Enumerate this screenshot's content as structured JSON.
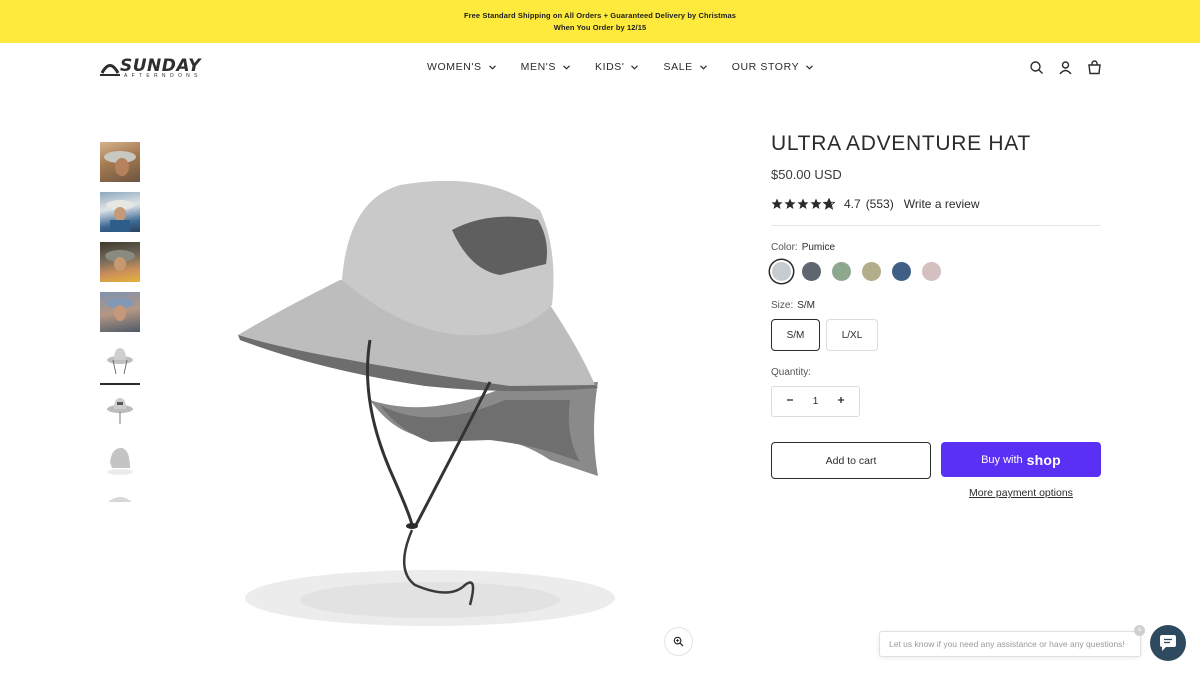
{
  "announcement": {
    "line1": "Free Standard Shipping on All Orders + Guaranteed Delivery by Christmas",
    "line2": "When You Order by 12/15"
  },
  "brand": {
    "name": "SUNDAY",
    "subtitle": "AFTERNOONS"
  },
  "nav": {
    "items": [
      {
        "label": "WOMEN'S"
      },
      {
        "label": "MEN'S"
      },
      {
        "label": "KIDS'"
      },
      {
        "label": "SALE"
      },
      {
        "label": "OUR STORY"
      }
    ]
  },
  "header_icons": [
    "search-icon",
    "account-icon",
    "cart-icon"
  ],
  "gallery": {
    "thumbnails": [
      "lifestyle-photo",
      "lifestyle-photo",
      "lifestyle-photo",
      "lifestyle-photo",
      "hat-front",
      "hat-side",
      "hat-back",
      "hat-top"
    ],
    "active_index": 4
  },
  "product": {
    "title": "ULTRA ADVENTURE HAT",
    "price": "$50.00 USD",
    "rating": "4.7",
    "rating_value": 4.7,
    "review_count": "(553)",
    "write_review": "Write a review",
    "color_label": "Color:",
    "color_value": "Pumice",
    "swatches": [
      {
        "color": "#c9cccf",
        "selected": true
      },
      {
        "color": "#5f6670"
      },
      {
        "color": "#8ea890"
      },
      {
        "color": "#b2ad8a"
      },
      {
        "color": "#3f5f85"
      },
      {
        "color": "#d4bfc1"
      }
    ],
    "size_label": "Size:",
    "size_value": "S/M",
    "sizes": [
      "S/M",
      "L/XL"
    ],
    "quantity_label": "Quantity:",
    "quantity": "1",
    "add_to_cart": "Add to cart",
    "buy_with": "Buy with",
    "shop_word": "shop",
    "more_payment": "More payment options"
  },
  "chat": {
    "prompt": "Let us know if you need any assistance or have any questions!",
    "close": "×"
  },
  "colors": {
    "announcement_bg": "#fdea3d",
    "shop_pay": "#5a31f4",
    "chat_button": "#2e4a5e"
  }
}
